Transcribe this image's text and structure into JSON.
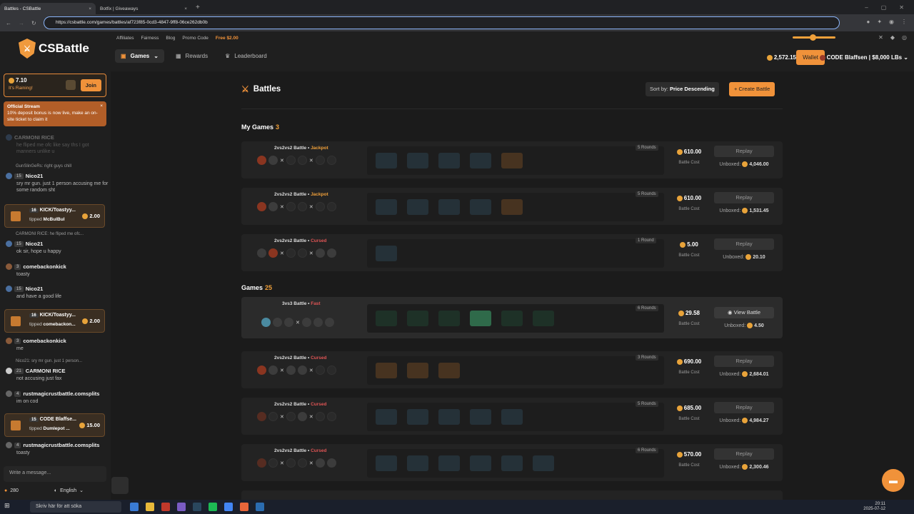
{
  "browser": {
    "tabs": [
      {
        "title": "Battles - CSBattle",
        "active": true
      },
      {
        "title": "Botfix | Giveaways",
        "active": false
      }
    ],
    "url": "https://csbattle.com/games/battles/af723f85-0cd3-4847-9ff8-06ce262db0b"
  },
  "top_links": [
    "Affiliates",
    "Fairness",
    "Blog",
    "Promo Code"
  ],
  "free_link": "Free $2.00",
  "nav": {
    "games": "Games",
    "rewards": "Rewards",
    "leaderboard": "Leaderboard"
  },
  "balance": "2,572.15",
  "wallet": "Wallet",
  "user": "CODE Blaffsen | $8,000 LBs",
  "logo": "CSBattle",
  "rain": {
    "amount": "7.10",
    "status": "It's Raining!",
    "join": "Join"
  },
  "stream": {
    "title": "Official Stream",
    "text": "10% deposit bonus is now live, make an on-site ticket to claim it",
    "close": "×"
  },
  "chat": [
    {
      "type": "msg",
      "name": "CARMONI RICE",
      "text": "he fliped me ofc like say ths I got manners unlike u",
      "faded": true
    },
    {
      "type": "reply",
      "text": "GunSlinGeRs: right guys chill"
    },
    {
      "type": "msg",
      "level": "15",
      "name": "Nico21",
      "text": "sry mr gun. just 1 person accusing me for some random sht"
    },
    {
      "type": "tip",
      "level": "16",
      "name": "KICK/Toastyy...",
      "to_prefix": "tipped",
      "to": "McBulBul",
      "amount": "2.00"
    },
    {
      "type": "reply",
      "text": "CARMONI RICE: he fliped me ofc..."
    },
    {
      "type": "msg",
      "level": "15",
      "name": "Nico21",
      "text": "ok sir, hope u happy"
    },
    {
      "type": "msg",
      "level": "3",
      "name": "comebackonkick",
      "text": "toasty"
    },
    {
      "type": "msg",
      "level": "15",
      "name": "Nico21",
      "text": "and have a good life"
    },
    {
      "type": "tip",
      "level": "16",
      "name": "KICK/Toastyy...",
      "to_prefix": "tipped",
      "to": "comebackon...",
      "amount": "2.00"
    },
    {
      "type": "msg",
      "level": "3",
      "name": "comebackonkick",
      "text": "me"
    },
    {
      "type": "reply",
      "text": "Nico21: sry mr gun. just 1 person..."
    },
    {
      "type": "msg",
      "level": "21",
      "name": "CARMONI RICE",
      "text": "not accusing just fax"
    },
    {
      "type": "msg",
      "level": "4",
      "name": "rustmagicrustbattle.comsplits",
      "text": "im on cod"
    },
    {
      "type": "tip",
      "level": "15",
      "name": "CODE Blaffse...",
      "to_prefix": "tipped",
      "to": "Dumlepot ...",
      "amount": "15.00"
    },
    {
      "type": "msg",
      "level": "4",
      "name": "rustmagicrustbattle.comsplits",
      "text": "toasty"
    }
  ],
  "chat_input": {
    "placeholder": "Write a message..."
  },
  "online": "280",
  "language": "English",
  "page": {
    "title": "Battles",
    "sort_label": "Sort by:",
    "sort_value": "Price Descending",
    "create": "+ Create Battle"
  },
  "my_games": {
    "label": "My Games",
    "count": "3"
  },
  "games": {
    "label": "Games",
    "count": "25"
  },
  "battles": [
    {
      "title": "2vs2vs2 Battle",
      "mode": "Jackpot",
      "rounds": "5 Rounds",
      "cost": "610.00",
      "cost_label": "Battle Cost",
      "button": "Replay",
      "unbox_label": "Unboxed:",
      "unboxed": "4,046.00"
    },
    {
      "title": "2vs2vs2 Battle",
      "mode": "Jackpot",
      "rounds": "5 Rounds",
      "cost": "610.00",
      "cost_label": "Battle Cost",
      "button": "Replay",
      "unbox_label": "Unboxed:",
      "unboxed": "1,531.45"
    },
    {
      "title": "2vs2vs2 Battle",
      "mode": "Cursed",
      "rounds": "1 Round",
      "cost": "5.00",
      "cost_label": "Battle Cost",
      "button": "Replay",
      "unbox_label": "Unboxed:",
      "unboxed": "20.10"
    },
    {
      "title": "3vs3 Battle",
      "mode": "Fast",
      "rounds": "6 Rounds",
      "cost": "29.58",
      "cost_label": "Battle Cost",
      "button": "View Battle",
      "unbox_label": "Unboxed:",
      "unboxed": "4.50"
    },
    {
      "title": "2vs2vs2 Battle",
      "mode": "Cursed",
      "rounds": "3 Rounds",
      "cost": "690.00",
      "cost_label": "Battle Cost",
      "button": "Replay",
      "unbox_label": "Unboxed:",
      "unboxed": "2,684.01"
    },
    {
      "title": "2vs2vs2 Battle",
      "mode": "Cursed",
      "rounds": "5 Rounds",
      "cost": "685.00",
      "cost_label": "Battle Cost",
      "button": "Replay",
      "unbox_label": "Unboxed:",
      "unboxed": "4,984.27"
    },
    {
      "title": "2vs2vs2 Battle",
      "mode": "Cursed",
      "rounds": "6 Rounds",
      "cost": "570.00",
      "cost_label": "Battle Cost",
      "button": "Replay",
      "unbox_label": "Unboxed:",
      "unboxed": "2,300.46"
    }
  ],
  "taskbar": {
    "search": "Skriv här för att söka",
    "time": "20:11",
    "date": "2025-07-12"
  },
  "colors": {
    "accent": "#f0923a",
    "jackpot": "#f0a03a",
    "cursed": "#e05555"
  }
}
